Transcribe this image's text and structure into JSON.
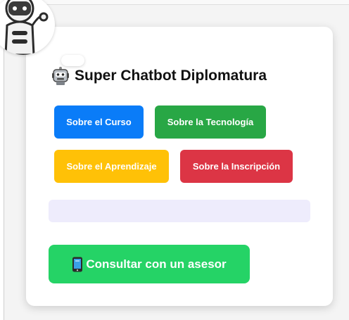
{
  "chatbot": {
    "title": "Super Chatbot Diplomatura",
    "avatar_icon": "robot-icon",
    "title_icon": "robot-face-icon"
  },
  "topics": [
    {
      "label": "Sobre el Curso",
      "color": "#0a7cf8"
    },
    {
      "label": "Sobre la Tecnología",
      "color": "#28a745"
    },
    {
      "label": "Sobre el Aprendizaje",
      "color": "#ffc107"
    },
    {
      "label": "Sobre la Inscripción",
      "color": "#dc3545"
    }
  ],
  "response": {
    "text": ""
  },
  "advisor": {
    "label": "Consultar con un asesor",
    "icon": "mobile-phone-icon",
    "color": "#25d366"
  }
}
